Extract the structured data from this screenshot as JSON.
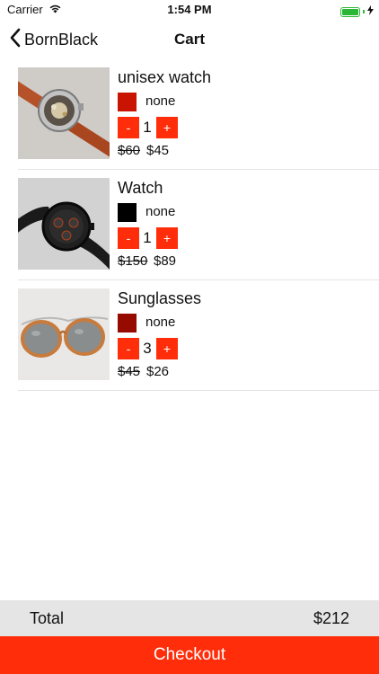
{
  "status_bar": {
    "carrier": "Carrier",
    "time": "1:54 PM",
    "battery_level": 1.0,
    "battery_color": "#2bb534"
  },
  "nav": {
    "back_label": "BornBlack",
    "title": "Cart",
    "back_icon": "chevron-left-icon"
  },
  "cart": {
    "items": [
      {
        "name": "unisex watch",
        "color_swatch": "#c81400",
        "color_label": "none",
        "minus_label": "-",
        "quantity": "1",
        "plus_label": "+",
        "old_price": "$60",
        "new_price": "$45",
        "image": "leather-watch-photo"
      },
      {
        "name": "Watch",
        "color_swatch": "#000000",
        "color_label": "none",
        "minus_label": "-",
        "quantity": "1",
        "plus_label": "+",
        "old_price": "$150",
        "new_price": "$89",
        "image": "black-watch-photo"
      },
      {
        "name": "Sunglasses",
        "color_swatch": "#960a00",
        "color_label": "none",
        "minus_label": "-",
        "quantity": "3",
        "plus_label": "+",
        "old_price": "$45",
        "new_price": "$26",
        "image": "wooden-sunglasses-photo"
      }
    ]
  },
  "footer": {
    "total_label": "Total",
    "total_value": "$212",
    "checkout_label": "Checkout"
  },
  "colors": {
    "accent": "#ff2d0a",
    "total_bar_bg": "#e5e5e5",
    "divider": "#e4e4e4"
  }
}
